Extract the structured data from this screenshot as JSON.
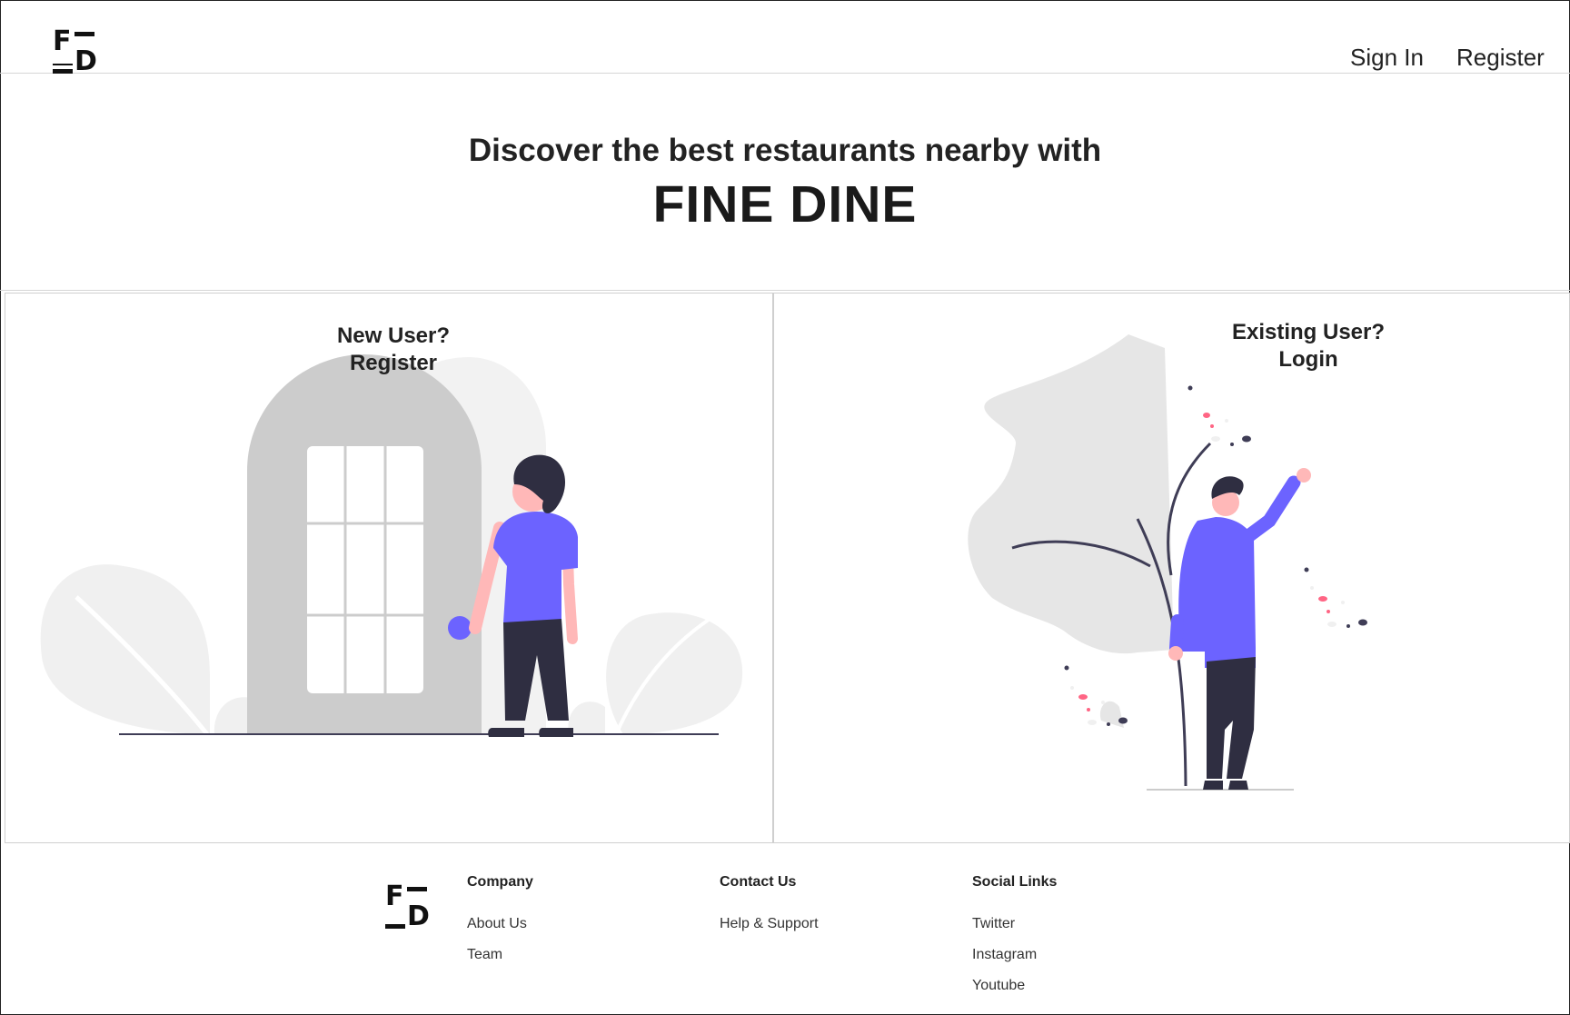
{
  "header": {
    "logo_letters": [
      "F",
      "D"
    ],
    "nav": {
      "signin": "Sign In",
      "register": "Register"
    }
  },
  "hero": {
    "subtitle": "Discover the best restaurants nearby with",
    "title": "FINE DINE"
  },
  "cards": {
    "register": {
      "line1": "New User?",
      "line2": "Register"
    },
    "login": {
      "line1": "Existing User?",
      "line2": "Login"
    }
  },
  "footer": {
    "company": {
      "heading": "Company",
      "links": [
        "About Us",
        "Team"
      ]
    },
    "contact": {
      "heading": "Contact Us",
      "links": [
        "Help & Support"
      ]
    },
    "social": {
      "heading": "Social Links",
      "links": [
        "Twitter",
        "Instagram",
        "Youtube"
      ]
    }
  },
  "colors": {
    "accent": "#6c63ff",
    "dark": "#2f2e41",
    "skin": "#ffb8b8",
    "door": "#cccccc",
    "leaf": "#f0f0f0",
    "pink": "#ff6584"
  }
}
